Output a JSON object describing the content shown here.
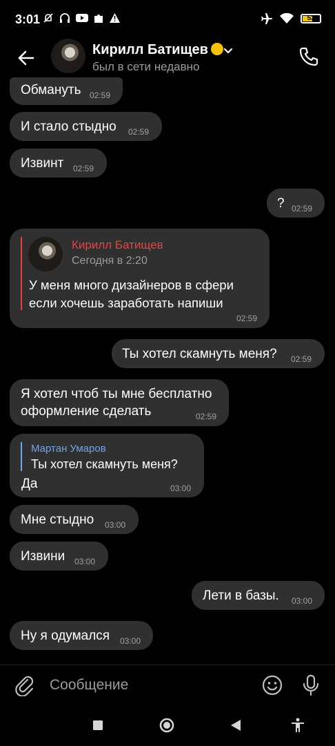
{
  "status_bar": {
    "time": "3:01",
    "battery": "53",
    "icons": [
      "mute-icon",
      "headset-icon",
      "youtube-icon",
      "puzzle-icon",
      "alert-icon",
      "airplane-icon",
      "wifi-icon",
      "battery-icon"
    ]
  },
  "header": {
    "contact_name": "Кирилл Батищев",
    "contact_status": "был в сети недавно",
    "icons": [
      "back-arrow-icon",
      "chevron-down-icon",
      "phone-icon"
    ]
  },
  "messages": [
    {
      "dir": "in",
      "text": "Обмануть",
      "time": "02:59"
    },
    {
      "dir": "in",
      "text": "И стало стыдно",
      "time": "02:59"
    },
    {
      "dir": "in",
      "text": "Извинт",
      "time": "02:59"
    },
    {
      "dir": "out",
      "text": "?",
      "time": "02:59"
    },
    {
      "dir": "in",
      "forwarded": {
        "name": "Кирилл Батищев",
        "date": "Сегодня в 2:20"
      },
      "text_line1": "У меня много дизайнеров в сфери",
      "text_line2": "если хочешь заработать напиши",
      "time": "02:59"
    },
    {
      "dir": "out",
      "text": "Ты хотел скамнуть меня?",
      "time": "02:59"
    },
    {
      "dir": "in",
      "text_line1": "Я хотел чтоб ты мне бесплатно",
      "text_line2": "оформление сделать",
      "time": "02:59"
    },
    {
      "dir": "in",
      "reply": {
        "name": "Мартан Умаров",
        "text": "Ты хотел скамнуть меня?"
      },
      "text": "Да",
      "time": "03:00"
    },
    {
      "dir": "in",
      "text": "Мне стыдно",
      "time": "03:00"
    },
    {
      "dir": "in",
      "text": "Извини",
      "time": "03:00"
    },
    {
      "dir": "out",
      "text": "Лети в базы.",
      "time": "03:00"
    },
    {
      "dir": "in",
      "text": "Ну я одумался",
      "time": "03:00"
    }
  ],
  "input": {
    "placeholder": "Сообщение"
  },
  "colors": {
    "bubble": "#303030",
    "forward_name": "#e5433f",
    "reply_name": "#71a6e8",
    "reply_bar": "#71a6e8",
    "forward_bar": "#e5433f",
    "muted": "#9b9b9b"
  }
}
